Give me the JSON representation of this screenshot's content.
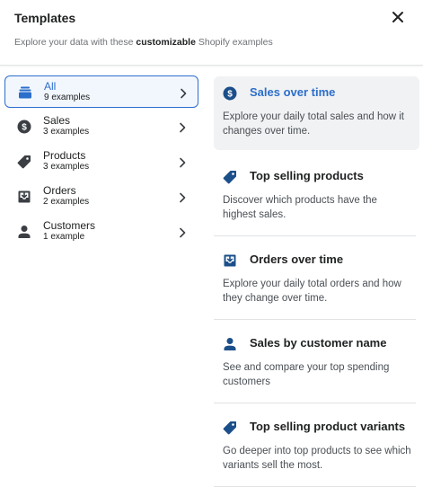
{
  "header": {
    "title": "Templates",
    "subtitle_before": "Explore your data with these ",
    "subtitle_bold": "customizable",
    "subtitle_after": " Shopify examples",
    "close_icon": "close-icon"
  },
  "categories": [
    {
      "icon": "all-icon",
      "name": "All",
      "count": "9 examples",
      "active": true
    },
    {
      "icon": "dollar-icon",
      "name": "Sales",
      "count": "3 examples",
      "active": false
    },
    {
      "icon": "tag-icon",
      "name": "Products",
      "count": "3 examples",
      "active": false
    },
    {
      "icon": "inbox-icon",
      "name": "Orders",
      "count": "2 examples",
      "active": false
    },
    {
      "icon": "person-icon",
      "name": "Customers",
      "count": "1 example",
      "active": false
    }
  ],
  "templates": [
    {
      "icon": "dollar-icon",
      "title": "Sales over time",
      "description": "Explore your daily total sales and how it changes over time.",
      "active": true
    },
    {
      "icon": "tag-icon",
      "title": "Top selling products",
      "description": "Discover which products have the highest sales.",
      "active": false
    },
    {
      "icon": "inbox-icon",
      "title": "Orders over time",
      "description": "Explore your daily total orders and how they change over time.",
      "active": false
    },
    {
      "icon": "person-icon",
      "title": "Sales by customer name",
      "description": "See and compare your top spending customers",
      "active": false
    },
    {
      "icon": "tag-icon",
      "title": "Top selling product variants",
      "description": "Go deeper into top products to see which variants sell the most.",
      "active": false
    }
  ],
  "colors": {
    "accent": "#2c6ecb",
    "icon_active": "#2c6ecb",
    "icon_default": "#3b3f44",
    "card_icon": "#1b4f8a"
  }
}
